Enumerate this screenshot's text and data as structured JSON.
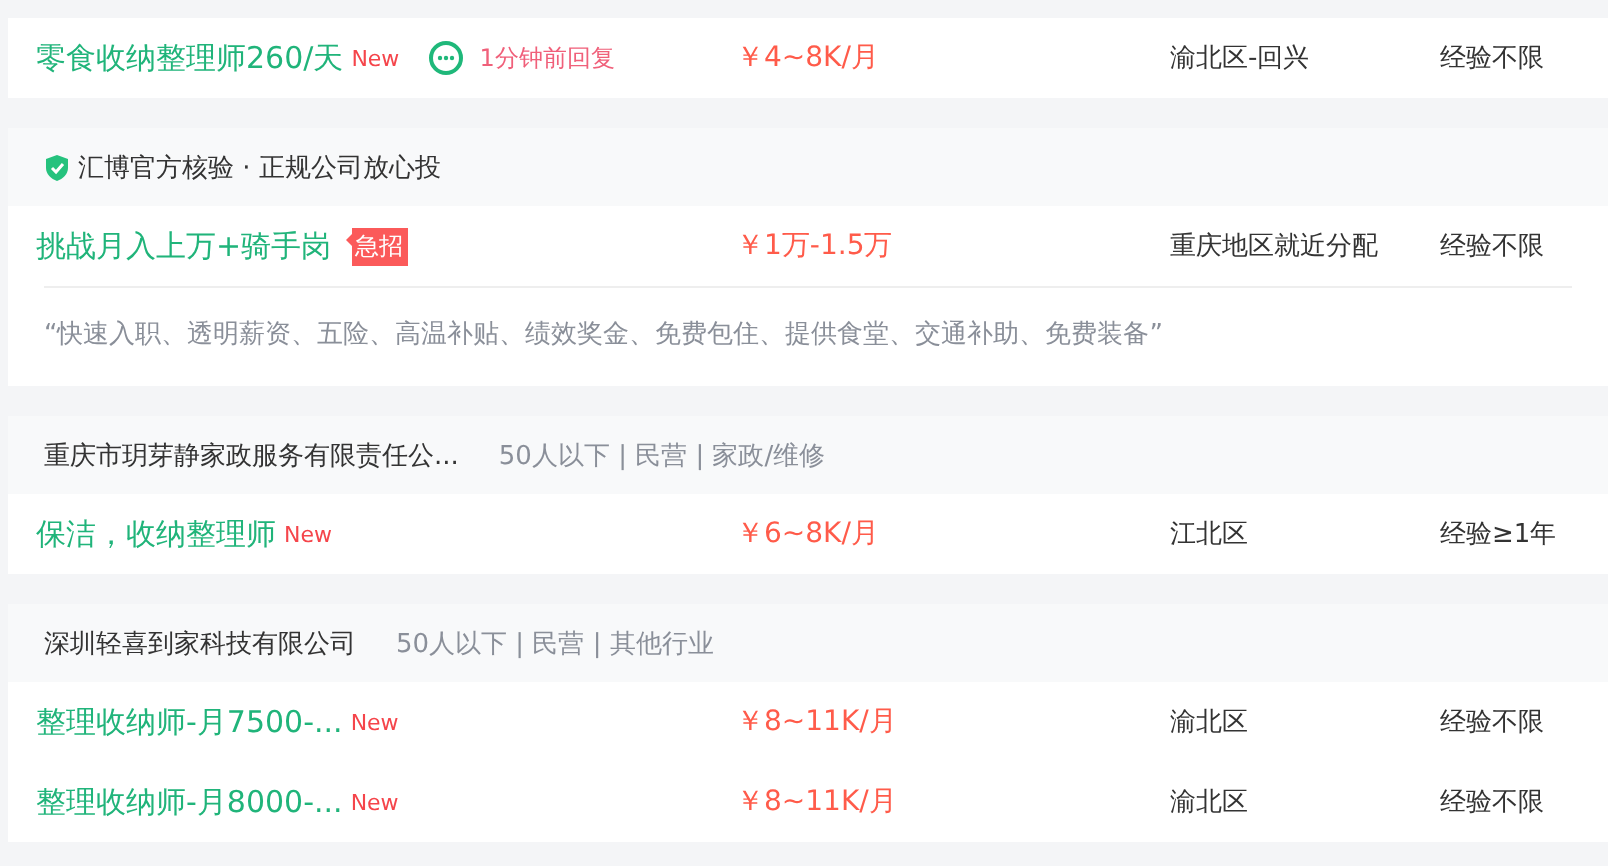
{
  "cards": [
    {
      "jobs": [
        {
          "title": "零食收纳整理师260/天",
          "tag": {
            "kind": "new",
            "text": "New"
          },
          "reply": "1分钟前回复",
          "salary": "￥4~8K/月",
          "location": "渝北区-回兴",
          "experience": "经验不限"
        }
      ]
    },
    {
      "header": {
        "kind": "verified",
        "text": "汇博官方核验 · 正规公司放心投"
      },
      "jobs": [
        {
          "title": "挑战月入上万+骑手岗",
          "tag": {
            "kind": "urgent",
            "text": "急招"
          },
          "salary": "￥1万-1.5万",
          "location": "重庆地区就近分配",
          "experience": "经验不限"
        }
      ],
      "description": "“快速入职、透明薪资、五险、高温补贴、绩效奖金、免费包住、提供食堂、交通补助、免费装备”"
    },
    {
      "header": {
        "kind": "company",
        "text": "重庆市玥芽静家政服务有限责任公...",
        "meta": "50人以下 | 民营 | 家政/维修"
      },
      "jobs": [
        {
          "title": "保洁，收纳整理师",
          "tag": {
            "kind": "new",
            "text": "New"
          },
          "salary": "￥6~8K/月",
          "location": "江北区",
          "experience": "经验≥1年"
        }
      ]
    },
    {
      "header": {
        "kind": "company",
        "text": "深圳轻喜到家科技有限公司",
        "meta": "50人以下 | 民营 | 其他行业"
      },
      "jobs": [
        {
          "title": "整理收纳师-月7500-...",
          "tag": {
            "kind": "new",
            "text": "New"
          },
          "salary": "￥8~11K/月",
          "location": "渝北区",
          "experience": "经验不限"
        },
        {
          "title": "整理收纳师-月8000-...",
          "tag": {
            "kind": "new",
            "text": "New"
          },
          "salary": "￥8~11K/月",
          "location": "渝北区",
          "experience": "经验不限"
        }
      ]
    }
  ]
}
